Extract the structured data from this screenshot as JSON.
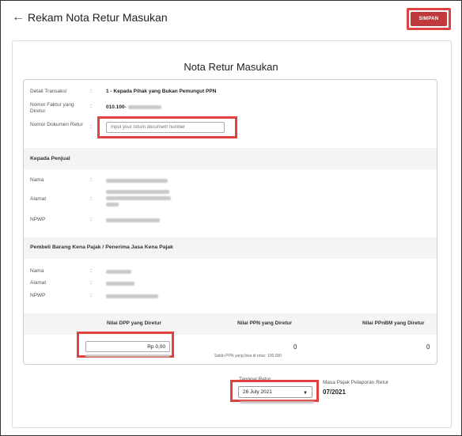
{
  "header": {
    "title": "Rekam Nota Retur Masukan",
    "save_label": "SIMPAN"
  },
  "card_title": "Nota Retur Masukan",
  "detail": {
    "transaksi_label": "Detail Transaksi",
    "transaksi_value": "1 - Kepada Pihak yang Bukan Pemungut PPN",
    "faktur_label": "Nomor Faktur yang Diretur",
    "faktur_value": "010.100-",
    "dokumen_label": "Nomor Dokumen Retur",
    "dokumen_placeholder": "Input your return document number"
  },
  "penjual": {
    "title": "Kepada Penjual",
    "nama_label": "Nama",
    "alamat_label": "Alamat",
    "npwp_label": "NPWP"
  },
  "pembeli": {
    "title": "Pembeli Barang Kena Pajak / Penerima Jasa Kena Pajak",
    "nama_label": "Nama",
    "alamat_label": "Alamat",
    "npwp_label": "NPWP"
  },
  "nilai": {
    "dpp_label": "Nilai DPP yang Diretur",
    "ppn_label": "Nilai PPN yang Diretur",
    "ppnbm_label": "Nilai PPnBM yang Diretur",
    "dpp_value": "Rp 0,00",
    "ppn_value": "0",
    "ppnbm_value": "0",
    "saldo_ppn": "Saldo PPN yang bisa di retur: 100.000"
  },
  "retur": {
    "tanggal_label": "Tanggal Retur",
    "tanggal_value": "26 July 2021",
    "masa_label": "Masa Pajak Pelaporan Retur",
    "masa_value": "07/2021"
  },
  "colon": ":"
}
